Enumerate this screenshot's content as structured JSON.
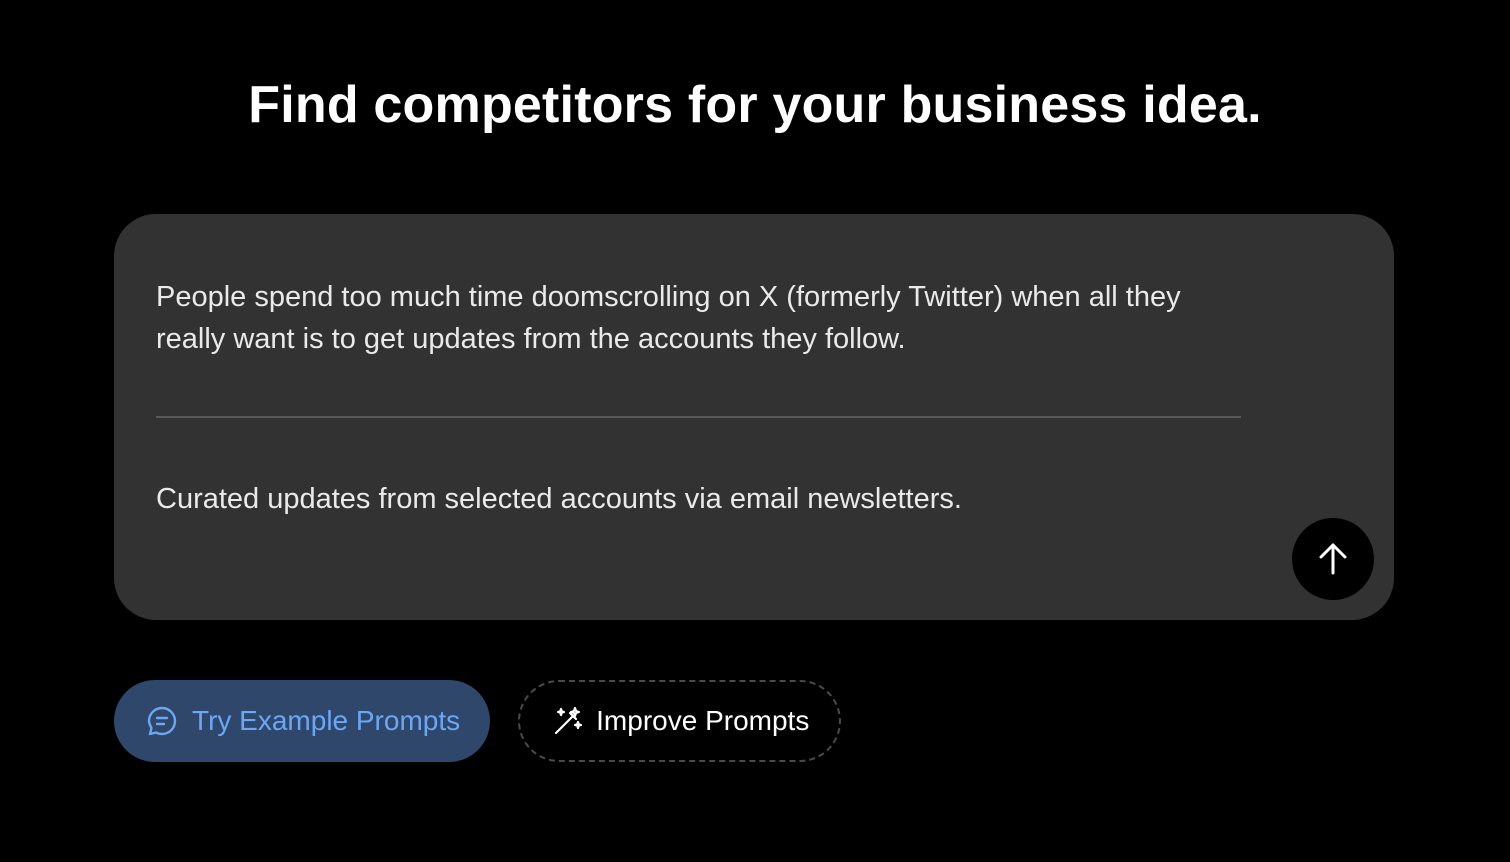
{
  "header": {
    "title": "Find competitors for your business idea."
  },
  "form": {
    "problem_value": "People spend too much time doomscrolling on X (formerly Twitter) when all they really want is to get updates from the accounts they follow.",
    "solution_value": "Curated updates from selected accounts via email newsletters.",
    "submit_icon": "arrow-up-icon"
  },
  "actions": {
    "try_examples_label": "Try Example Prompts",
    "try_examples_icon": "chat-bubble-icon",
    "improve_label": "Improve Prompts",
    "improve_icon": "magic-wand-icon"
  },
  "colors": {
    "background": "#000000",
    "card": "#323232",
    "primary_button_bg": "#2f476b",
    "primary_button_text": "#6aa8f5"
  }
}
